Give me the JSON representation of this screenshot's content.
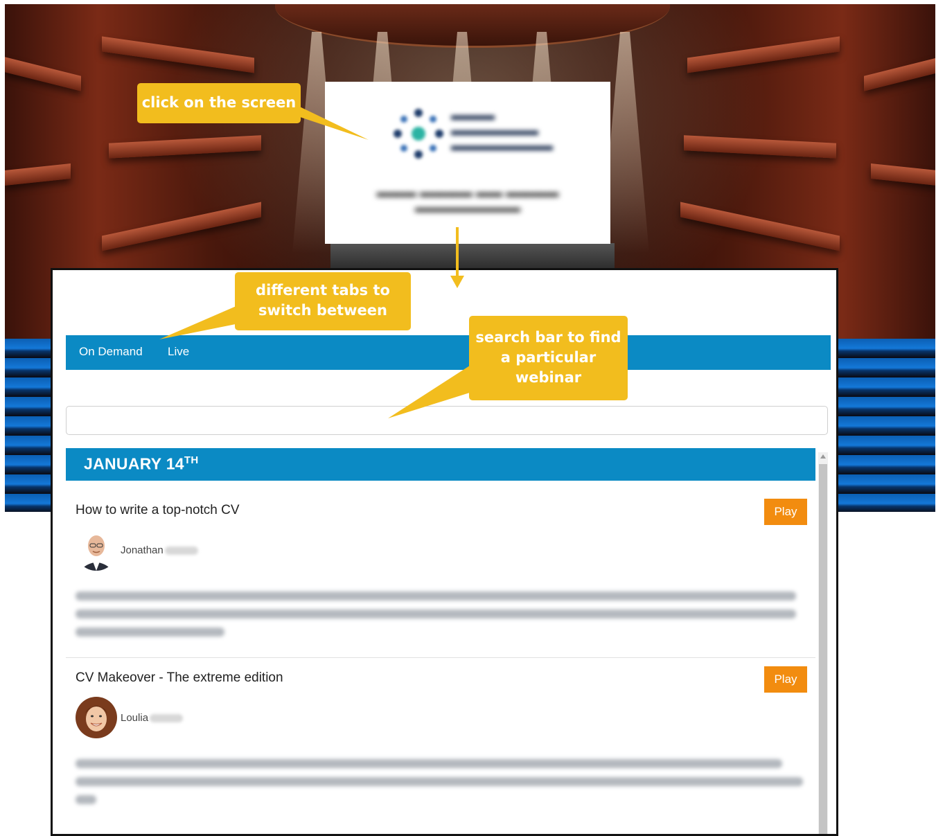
{
  "callouts": {
    "screen_hint": "click on the screen",
    "tabs_hint_line1": "different tabs to",
    "tabs_hint_line2": "switch between",
    "search_hint_line1": "search bar to find",
    "search_hint_line2": "a particular",
    "search_hint_line3": "webinar"
  },
  "tabs": [
    {
      "label": "On Demand"
    },
    {
      "label": "Live"
    }
  ],
  "search": {
    "value": "",
    "placeholder": ""
  },
  "date_band": {
    "label": "JANUARY 14",
    "suffix": "TH"
  },
  "sessions": [
    {
      "title": "How to write a top-notch CV",
      "speaker_first_name": "Jonathan",
      "play_label": "Play"
    },
    {
      "title": "CV Makeover - The extreme edition",
      "speaker_first_name": "Loulia",
      "play_label": "Play"
    }
  ],
  "colors": {
    "accent_blue": "#0b8ac4",
    "play_orange": "#f28c0f",
    "callout_yellow": "#f2bd1e"
  }
}
